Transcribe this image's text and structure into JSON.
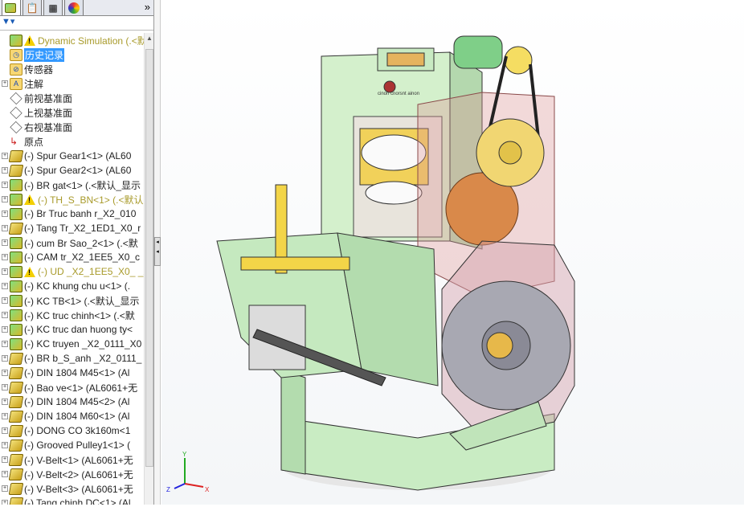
{
  "panel": {
    "more": "»",
    "filter_icon": "funnel-icon"
  },
  "tree": [
    {
      "label": "Dynamic Simulation  (.<默",
      "icon": "assembly",
      "warn": true,
      "style": "w"
    },
    {
      "label": "历史记录",
      "icon": "history",
      "selected": true
    },
    {
      "label": "传感器",
      "icon": "sensor"
    },
    {
      "label": "注解",
      "icon": "annotation",
      "exp": true
    },
    {
      "label": "前视基准面",
      "icon": "plane"
    },
    {
      "label": "上视基准面",
      "icon": "plane"
    },
    {
      "label": "右视基准面",
      "icon": "plane"
    },
    {
      "label": "原点",
      "icon": "origin"
    },
    {
      "label": "(-) Spur Gear1<1> (AL60",
      "icon": "part",
      "exp": true
    },
    {
      "label": "(-) Spur Gear2<1> (AL60",
      "icon": "part",
      "exp": true
    },
    {
      "label": "(-) BR gat<1> (.<默认_显示",
      "icon": "asm",
      "exp": true
    },
    {
      "label": "(-) TH_S_BN<1> (.<默认",
      "icon": "asm",
      "exp": true,
      "warn": true,
      "style": "w"
    },
    {
      "label": "(-) Br Truc banh r_X2_010",
      "icon": "asm",
      "exp": true
    },
    {
      "label": "(-) Tang Tr_X2_1ED1_X0_r",
      "icon": "part",
      "exp": true
    },
    {
      "label": "(-) cum Br Sao_2<1> (.<默",
      "icon": "asm",
      "exp": true
    },
    {
      "label": "(-) CAM tr_X2_1EE5_X0_c",
      "icon": "asm",
      "exp": true
    },
    {
      "label": "(-) UD _X2_1EE5_X0_ _X",
      "icon": "asm",
      "exp": true,
      "warn": true,
      "style": "w"
    },
    {
      "label": "(-) KC khung chu u<1> (.",
      "icon": "asm",
      "exp": true
    },
    {
      "label": "(-) KC TB<1> (.<默认_显示",
      "icon": "asm",
      "exp": true
    },
    {
      "label": "(-) KC truc chinh<1> (.<默",
      "icon": "asm",
      "exp": true
    },
    {
      "label": "(-) KC truc dan huong ty<",
      "icon": "asm",
      "exp": true
    },
    {
      "label": "(-) KC truyen _X2_0111_X0",
      "icon": "asm",
      "exp": true
    },
    {
      "label": "(-) BR b_S_anh _X2_0111_",
      "icon": "part",
      "exp": true
    },
    {
      "label": "(-) DIN 1804 M45<1> (Al",
      "icon": "part",
      "exp": true
    },
    {
      "label": "(-) Bao ve<1> (AL6061+无",
      "icon": "part",
      "exp": true
    },
    {
      "label": "(-) DIN 1804 M45<2> (Al",
      "icon": "part",
      "exp": true
    },
    {
      "label": "(-) DIN 1804 M60<1> (Al",
      "icon": "part",
      "exp": true
    },
    {
      "label": "(-) DONG CO 3k160m<1",
      "icon": "part",
      "exp": true
    },
    {
      "label": "(-) Grooved Pulley1<1> (",
      "icon": "part",
      "exp": true
    },
    {
      "label": "(-) V-Belt<1> (AL6061+无",
      "icon": "part",
      "exp": true
    },
    {
      "label": "(-) V-Belt<2> (AL6061+无",
      "icon": "part",
      "exp": true
    },
    {
      "label": "(-) V-Belt<3> (AL6061+无",
      "icon": "part",
      "exp": true
    },
    {
      "label": "(-) Tang chinh DC<1> (Al",
      "icon": "part",
      "exp": true
    }
  ],
  "triad": {
    "x": "X",
    "y": "Y",
    "z": "Z"
  },
  "model": {
    "plate_text": "cinon cnorsnt ainon"
  }
}
